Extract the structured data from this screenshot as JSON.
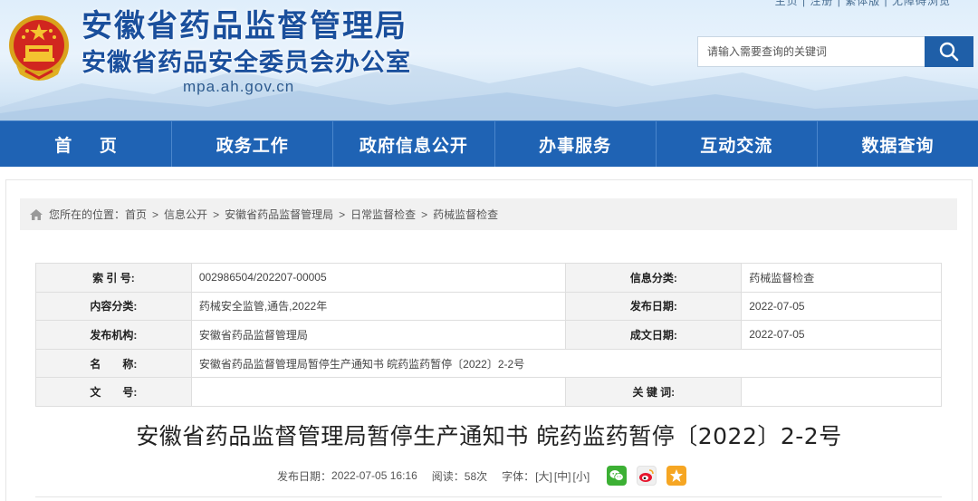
{
  "header": {
    "top_links": "主页 | 注册 | 繁体版 | 无障碍浏览",
    "title": "安徽省药品监督管理局",
    "subtitle": "安徽省药品安全委员会办公室",
    "domain": "mpa.ah.gov.cn",
    "search": {
      "placeholder": "请输入需要查询的关键词"
    }
  },
  "nav": {
    "items": [
      {
        "label": "首 页"
      },
      {
        "label": "政务工作"
      },
      {
        "label": "政府信息公开"
      },
      {
        "label": "办事服务"
      },
      {
        "label": "互动交流"
      },
      {
        "label": "数据查询"
      }
    ]
  },
  "breadcrumb": {
    "prefix": "您所在的位置：",
    "items": [
      "首页",
      "信息公开",
      "安徽省药品监督管理局",
      "日常监督检查",
      "药械监督检查"
    ],
    "separator": ">"
  },
  "info": {
    "index_label": "索 引 号:",
    "index_value": "002986504/202207-00005",
    "category_label": "信息分类:",
    "category_value": "药械监督检查",
    "content_label": "内容分类:",
    "content_value": "药械安全监管,通告,2022年",
    "publish_label": "发布日期:",
    "publish_value": "2022-07-05",
    "org_label": "发布机构:",
    "org_value": "安徽省药品监督管理局",
    "made_label": "成文日期:",
    "made_value": "2022-07-05",
    "name_label": "名　　称:",
    "name_value": "安徽省药品监督管理局暂停生产通知书 皖药监药暂停〔2022〕2-2号",
    "docno_label": "文　　号:",
    "docno_value": "",
    "keywords_label": "关 键 词:",
    "keywords_value": ""
  },
  "article": {
    "title": "安徽省药品监督管理局暂停生产通知书 皖药监药暂停〔2022〕2-2号",
    "date_label": "发布日期：",
    "date_value": "2022-07-05 16:16",
    "reads_label": "阅读：",
    "reads_value": "58次",
    "font_label": "字体：",
    "font_large": "[大]",
    "font_medium": "[中]",
    "font_small": "[小]"
  },
  "colors": {
    "brand_blue": "#1f63b4",
    "title_blue": "#1a4f9c",
    "wechat_green": "#3cb034",
    "weibo_red": "#e6162d",
    "qzone_orange": "#f6a623"
  },
  "icons": [
    "national-emblem",
    "search-icon",
    "home-icon",
    "wechat-icon",
    "weibo-icon",
    "qzone-icon"
  ]
}
